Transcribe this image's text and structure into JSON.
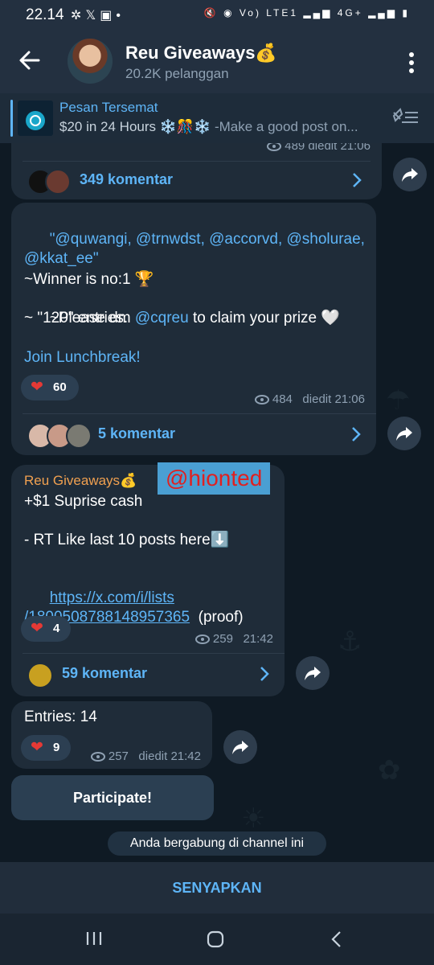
{
  "status_bar": {
    "time": "22.14",
    "left_icons": [
      "pinwheel-icon",
      "x-logo-icon",
      "tv-icon",
      "dot-icon"
    ],
    "right_icons": [
      "mute-icon",
      "hotspot-icon",
      "volte-icon",
      "signal-icon",
      "4g-icon",
      "signal-icon",
      "battery-icon"
    ],
    "volte_text": "Vo) LTE1",
    "network_text": "4G+"
  },
  "header": {
    "title": "Reu Giveaways💰",
    "subscribers": "20.2K pelanggan"
  },
  "pinned": {
    "label": "Pesan Tersemat",
    "text_main": "$20 in 24 Hours ❄️🎊❄️",
    "text_dim": " -Make a good post on..."
  },
  "messages": {
    "partial": {
      "meta": "489   diedit 21:06",
      "comments": "349 komentar"
    },
    "winner": {
      "line1_mentions": "\"@quwangi, @trnwdst, @accorvd, @sholurae,",
      "line2_mentions": "@kkat_ee\"",
      "winner_line": "~Winner is no:1 🏆",
      "dm_prefix": "~Please dm ",
      "dm_mention": "@cqreu",
      "dm_suffix": " to claim your prize 🤍",
      "entries_line": "~ \"120\" entries.",
      "join_link": "Join Lunchbreak!",
      "reaction_count": "60",
      "views": "484",
      "edited_time": "diedit 21:06",
      "comments": "5 komentar"
    },
    "forward": {
      "author": "Reu Giveaways💰",
      "line1": "+$1 Suprise cash",
      "overlay_tag": "@hionted",
      "line2": "- RT Like last 10 posts here⬇️",
      "link_line1": "https://x.com/i/lists",
      "link_line2": "/1800508788148957365",
      "link_suffix": "  (proof)",
      "reaction_count": "4",
      "views": "259",
      "time": "21:42",
      "comments": "59 komentar"
    },
    "entries": {
      "text": "Entries: 14",
      "reaction_count": "9",
      "views": "257",
      "edited_time": "diedit 21:42"
    }
  },
  "participate_button": "Participate!",
  "joined_notice": "Anda bergabung di channel ini",
  "bottom_action": "SENYAPKAN",
  "colors": {
    "accent": "#5eb5f7",
    "bubble": "#1f2c39",
    "background": "#0f1a24",
    "header": "#233040",
    "heart": "#e53935",
    "forward_author": "#f0a050"
  }
}
